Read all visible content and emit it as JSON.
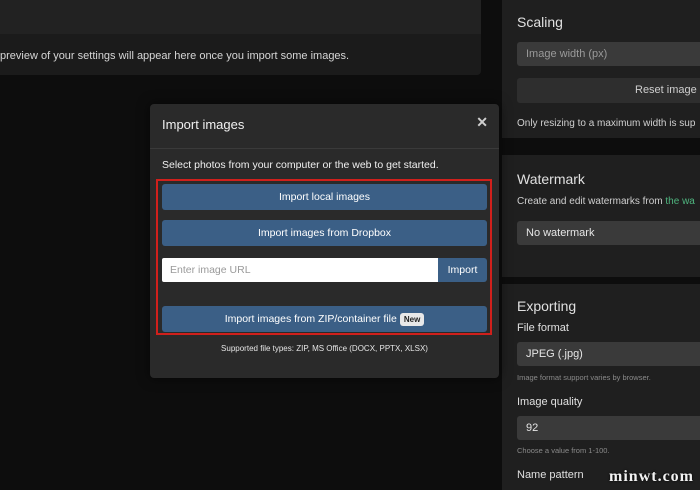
{
  "preview": {
    "message": "preview of your settings will appear here once you import some images."
  },
  "sidebar": {
    "scaling": {
      "title": "Scaling",
      "width_placeholder": "Image width (px)",
      "reset_label": "Reset image scale",
      "note": "Only resizing to a maximum width is sup"
    },
    "watermark": {
      "title": "Watermark",
      "desc": "Create and edit watermarks from ",
      "link": "the wa",
      "selected": "No watermark"
    },
    "exporting": {
      "title": "Exporting",
      "format_label": "File format",
      "format_value": "JPEG (.jpg)",
      "format_hint": "Image format support varies by browser.",
      "quality_label": "Image quality",
      "quality_value": "92",
      "quality_hint": "Choose a value from 1-100.",
      "name_label": "Name pattern"
    }
  },
  "modal": {
    "title": "Import images",
    "close_glyph": "✕",
    "description": "Select photos from your computer or the web to get started.",
    "local_label": "Import local images",
    "dropbox_label": "Import images from Dropbox",
    "url_placeholder": "Enter image URL",
    "url_import_label": "Import",
    "zip_label": "Import images from ZIP/container file",
    "new_badge": "New",
    "supported": "Supported file types: ZIP, MS Office (DOCX, PPTX, XLSX)"
  },
  "watermark_logo": "minwt.com",
  "colors": {
    "accent_blue": "#3b5f86",
    "highlight_red": "#d0201c",
    "link_green": "#4fb57f"
  }
}
